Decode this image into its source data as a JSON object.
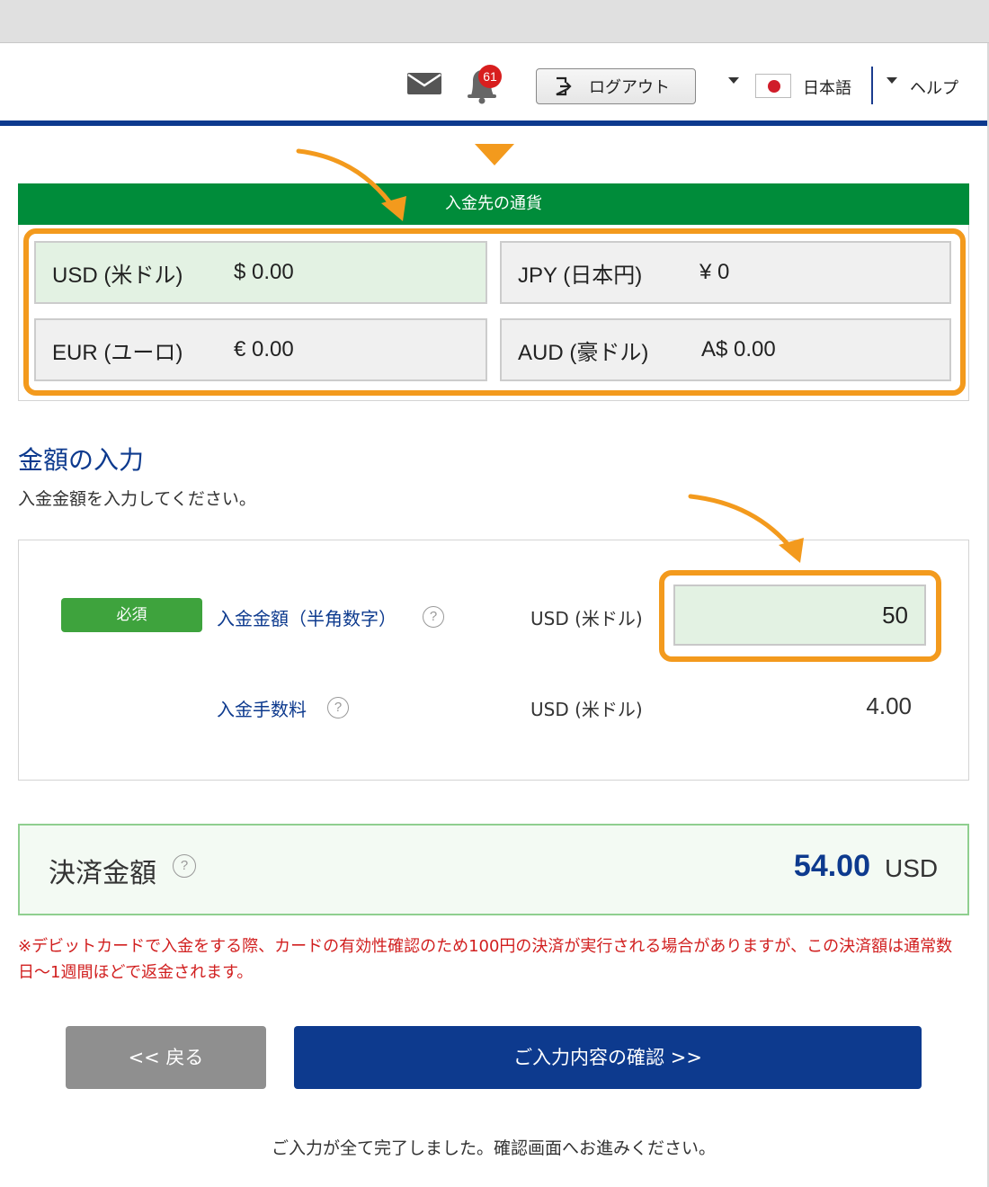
{
  "header": {
    "notification_count": "61",
    "logout_label": "ログアウト",
    "language_label": "日本語",
    "help_label": "ヘルプ"
  },
  "currency": {
    "title": "入金先の通貨",
    "items": [
      {
        "name": "USD (米ドル)",
        "amount": "$ 0.00",
        "selected": true
      },
      {
        "name": "JPY (日本円)",
        "amount": "¥ 0",
        "selected": false
      },
      {
        "name": "EUR (ユーロ)",
        "amount": "€ 0.00",
        "selected": false
      },
      {
        "name": "AUD (豪ドル)",
        "amount": "A$ 0.00",
        "selected": false
      }
    ]
  },
  "amount_section": {
    "title": "金額の入力",
    "subtitle": "入金金額を入力してください。",
    "required_label": "必須",
    "deposit_label": "入金金額（半角数字）",
    "deposit_unit": "USD (米ドル)",
    "deposit_value": "50",
    "fee_label": "入金手数料",
    "fee_unit": "USD (米ドル)",
    "fee_value": "4.00",
    "help_glyph": "?"
  },
  "total": {
    "label": "決済金額",
    "value": "54.00",
    "unit": "USD"
  },
  "notice": "※デビットカードで入金をする際、カードの有効性確認のため100円の決済が実行される場合がありますが、この決済額は通常数日〜1週間ほどで返金されます。",
  "buttons": {
    "back": "<< 戻る",
    "confirm": "ご入力内容の確認 >>"
  },
  "completion_message": "ご入力が全て完了しました。確認画面へお進みください。",
  "colors": {
    "brand_navy": "#0d3a8e",
    "header_green": "#008c3a",
    "highlight_orange": "#f39a1d",
    "required_green": "#3ea33d",
    "notice_red": "#d11f1f"
  }
}
